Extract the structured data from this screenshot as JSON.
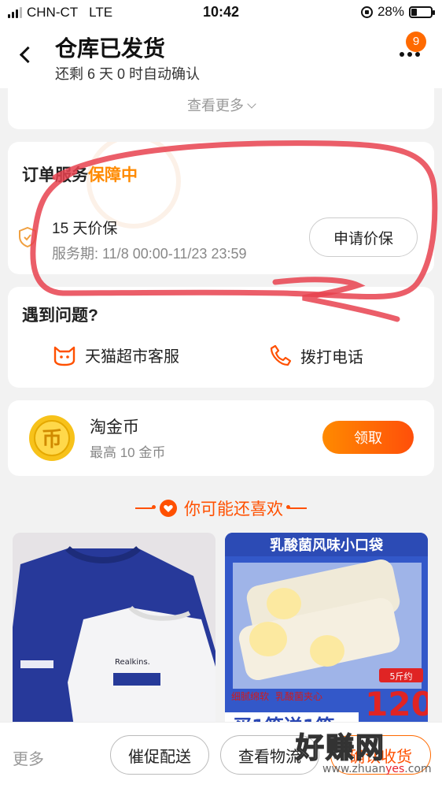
{
  "status_bar": {
    "carrier": "CHN-CT",
    "network": "LTE",
    "time": "10:42",
    "battery": "28%",
    "battery_level": 0.28
  },
  "header": {
    "title": "仓库已发货",
    "subtitle": "还剩 6 天 0 时自动确认",
    "badge_count": "9"
  },
  "top_card": {
    "see_more": "查看更多"
  },
  "service": {
    "title_prefix": "订单服务",
    "title_accent": "保障中",
    "item_name": "15 天价保",
    "item_period": "服务期: 11/8 00:00-11/23 23:59",
    "apply_label": "申请价保"
  },
  "problem": {
    "title": "遇到问题?",
    "customer_service": "天猫超市客服",
    "call": "拨打电话"
  },
  "coin": {
    "name": "淘金币",
    "desc": "最高 10 金币",
    "claim": "领取",
    "coin_glyph": "币"
  },
  "recommend": {
    "title": "你可能还喜欢",
    "left_brand": "Realkins.",
    "right_banner": "乳酸菌风味小口袋",
    "right_tag1": "细腻绵软",
    "right_tag2": "乳酸菌夹心",
    "right_weight": "5斤约",
    "right_count": "120",
    "right_promo": "买1箱送1箱"
  },
  "bottom": {
    "more": "更多",
    "urge": "催促配送",
    "logistics": "查看物流",
    "confirm": "确认收货"
  },
  "watermark": {
    "main": "好赚网",
    "sub_prefix": "www.zhuan",
    "sub_accent": "yes",
    "sub_suffix": ".com"
  },
  "colors": {
    "accent": "#ff5000",
    "annotation": "#e8424f"
  }
}
